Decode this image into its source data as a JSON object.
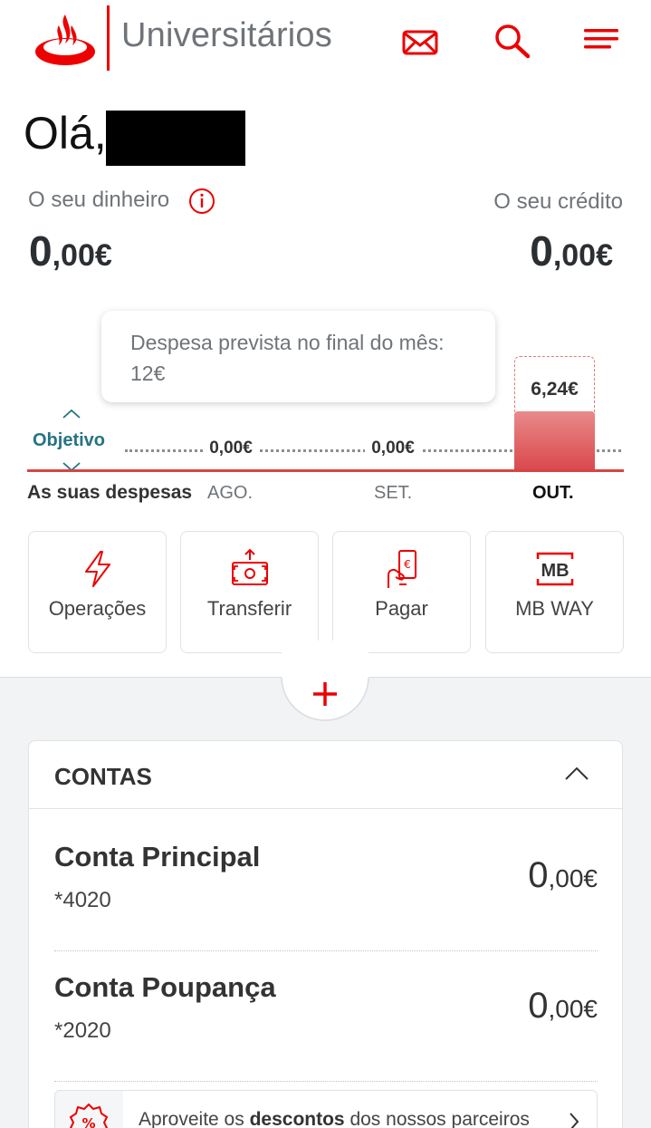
{
  "header": {
    "brand": "Universitários",
    "icons": [
      "santander-logo",
      "mail-icon",
      "search-icon",
      "menu-icon"
    ]
  },
  "greeting": "Olá,",
  "summary": {
    "money_label": "O seu dinheiro",
    "money_int": "0",
    "money_dec": ",00€",
    "credit_label": "O seu crédito",
    "credit_int": "0",
    "credit_dec": ",00€"
  },
  "spending": {
    "tooltip_line1": "Despesa prevista no final do mês:",
    "tooltip_line2": "12€",
    "goal_label": "Objetivo",
    "section_label": "As suas despesas",
    "months": [
      {
        "label": "AGO.",
        "value": "0,00€"
      },
      {
        "label": "SET.",
        "value": "0,00€"
      },
      {
        "label": "OUT.",
        "value": "6,24€"
      }
    ],
    "current_fill_fraction": 0.52
  },
  "actions": [
    {
      "label": "Operações",
      "icon": "lightning-icon"
    },
    {
      "label": "Transferir",
      "icon": "transfer-icon"
    },
    {
      "label": "Pagar",
      "icon": "pay-icon"
    },
    {
      "label": "MB WAY",
      "icon": "mbway-icon"
    }
  ],
  "accounts": {
    "title": "CONTAS",
    "items": [
      {
        "name": "Conta Principal",
        "number": "*4020",
        "bal_int": "0",
        "bal_dec": ",00€"
      },
      {
        "name": "Conta Poupança",
        "number": "*2020",
        "bal_int": "0",
        "bal_dec": ",00€"
      }
    ]
  },
  "promo": {
    "pre": "Aproveite os ",
    "bold": "descontos",
    "post": " dos nossos parceiros"
  },
  "colors": {
    "brand_red": "#ec0000",
    "teal": "#257482",
    "grey_text": "#6f7479"
  }
}
